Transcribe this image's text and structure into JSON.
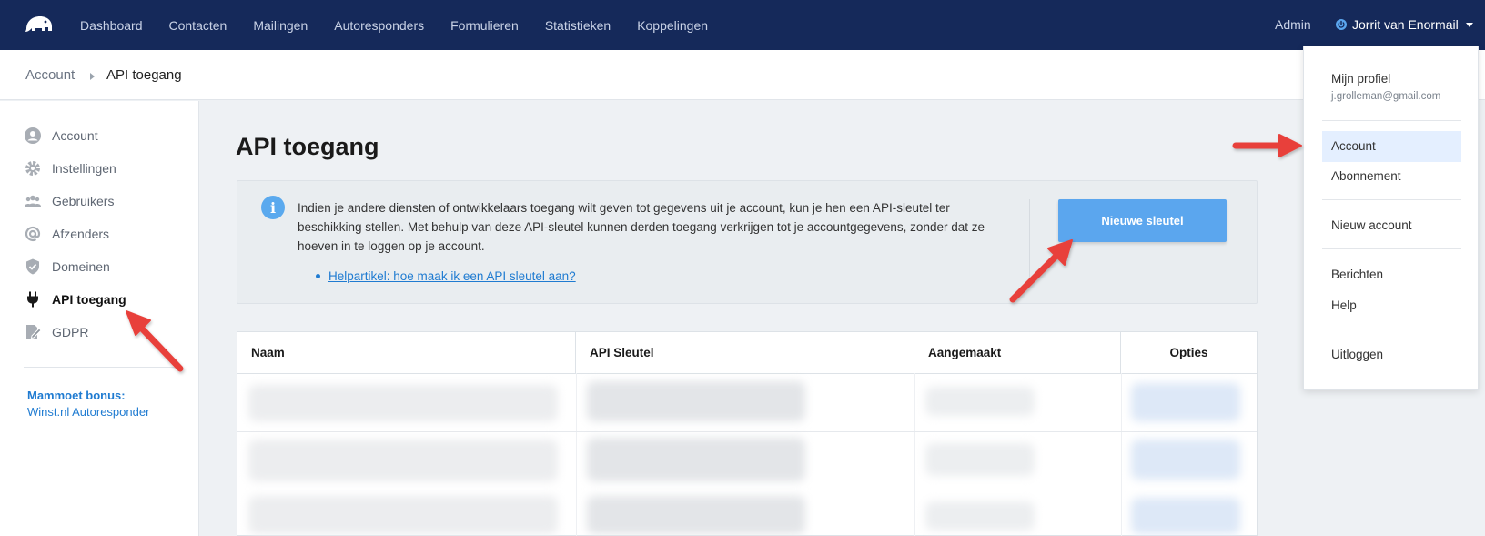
{
  "nav": {
    "items": [
      "Dashboard",
      "Contacten",
      "Mailingen",
      "Autoresponders",
      "Formulieren",
      "Statistieken",
      "Koppelingen"
    ],
    "admin_label": "Admin",
    "user_name": "Jorrit van Enormail"
  },
  "breadcrumb": {
    "parent": "Account",
    "current": "API toegang"
  },
  "sidebar": {
    "items": [
      {
        "label": "Account",
        "icon": "user-circle-icon"
      },
      {
        "label": "Instellingen",
        "icon": "gear-icon"
      },
      {
        "label": "Gebruikers",
        "icon": "users-icon"
      },
      {
        "label": "Afzenders",
        "icon": "at-sign-icon"
      },
      {
        "label": "Domeinen",
        "icon": "shield-check-icon"
      },
      {
        "label": "API toegang",
        "icon": "plug-icon"
      },
      {
        "label": "GDPR",
        "icon": "document-edit-icon"
      }
    ],
    "bonus_title": "Mammoet bonus:",
    "bonus_link": "Winst.nl Autoresponder"
  },
  "main": {
    "title": "API toegang",
    "info_text": "Indien je andere diensten of ontwikkelaars toegang wilt geven tot gegevens uit je account, kun je hen een API-sleutel ter beschikking stellen. Met behulp van deze API-sleutel kunnen derden toegang verkrijgen tot je accountgegevens, zonder dat ze hoeven in te loggen op je account.",
    "help_link": "Helpartikel: hoe maak ik een API sleutel aan?",
    "new_key_button": "Nieuwe sleutel"
  },
  "table": {
    "columns": [
      "Naam",
      "API Sleutel",
      "Aangemaakt",
      "Opties"
    ]
  },
  "dropdown": {
    "profile_label": "Mijn profiel",
    "email": "j.grolleman@gmail.com",
    "account": "Account",
    "subscription": "Abonnement",
    "new_account": "Nieuw account",
    "messages": "Berichten",
    "help": "Help",
    "logout": "Uitloggen"
  },
  "colors": {
    "nav_bg": "#15295a",
    "accent": "#1f7bd1",
    "button": "#5ba6ee",
    "annotation_arrow": "#e8403a"
  }
}
